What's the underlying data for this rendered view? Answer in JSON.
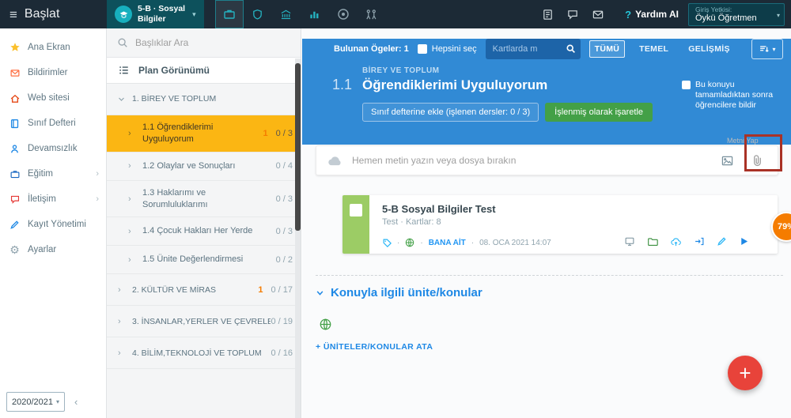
{
  "topbar": {
    "menu_label": "Başlat",
    "class_selector": {
      "line1": "5-B · Sosyal",
      "line2": "Bilgiler"
    },
    "help": {
      "q": "?",
      "label": "Yardım AI"
    },
    "role_box": {
      "label": "Giriş Yetkisi:",
      "value": "Öykü Öğretmen"
    }
  },
  "sidebar": {
    "items": [
      {
        "label": "Ana Ekran",
        "icon": "star-icon"
      },
      {
        "label": "Bildirimler",
        "icon": "mail-icon"
      },
      {
        "label": "Web sitesi",
        "icon": "home-icon"
      },
      {
        "label": "Sınıf Defteri",
        "icon": "notebook-icon"
      },
      {
        "label": "Devamsızlık",
        "icon": "person-icon"
      },
      {
        "label": "Eğitim",
        "icon": "briefcase-icon",
        "chevron": true
      },
      {
        "label": "İletişim",
        "icon": "chat-icon",
        "chevron": true
      },
      {
        "label": "Kayıt Yönetimi",
        "icon": "pen-icon"
      },
      {
        "label": "Ayarlar",
        "icon": "gear-icon"
      }
    ],
    "year": "2020/2021",
    "collapse_icon": "‹",
    "gear_glyph": "⚙"
  },
  "plan_panel": {
    "search_placeholder": "Başlıklar Ara",
    "view_label": "Plan Görünümü",
    "items": [
      {
        "label": "1. BİREY VE TOPLUM",
        "type": "unit",
        "expanded": true
      },
      {
        "label": "1.1 Öğrendiklerimi Uyguluyorum",
        "badge": "1",
        "count": "0 / 3",
        "type": "topic",
        "active": true
      },
      {
        "label": "1.2 Olaylar ve Sonuçları",
        "count": "0 / 4",
        "type": "topic"
      },
      {
        "label": "1.3 Haklarımı ve Sorumluluklarımı",
        "count": "0 / 3",
        "type": "topic"
      },
      {
        "label": "1.4 Çocuk Hakları Her Yerde",
        "count": "0 / 3",
        "type": "topic"
      },
      {
        "label": "1.5 Ünite Değerlendirmesi",
        "count": "0 / 2",
        "type": "topic"
      },
      {
        "label": "2. KÜLTÜR VE MİRAS",
        "badge": "1",
        "count": "0 / 17",
        "type": "unit"
      },
      {
        "label": "3. İNSANLAR,YERLER VE ÇEVRELER",
        "count": "0 / 19",
        "type": "unit"
      },
      {
        "label": "4. BİLİM,TEKNOLOJİ VE TOPLUM",
        "count": "0 / 16",
        "type": "unit"
      }
    ]
  },
  "main": {
    "toolbar": {
      "found": "Bulunan Ögeler: 1",
      "select_all": "Hepsini seç",
      "search_placeholder": "Kartlarda m",
      "filter_all": "TÜMÜ",
      "filter_basic": "TEMEL",
      "filter_advanced": "GELİŞMİŞ"
    },
    "topic_header": {
      "unit": "BİREY VE TOPLUM",
      "number": "1.1",
      "title": "Öğrendiklerimi Uyguluyorum",
      "add_to_classbook": "Sınıf defterine ekle (işlenen dersler: 0 / 3)",
      "mark_done": "İşlenmiş olarak işaretle",
      "notify": "Bu konuyu tamamladıktan sonra öğrencilere bildir"
    },
    "composer": {
      "hint": "Hemen metin yazın veya dosya bırakın",
      "meta_top": "Metni Yap",
      "meta_bottom": "textarea"
    },
    "card": {
      "title": "5-B Sosyal Bilgiler Test",
      "subtitle": "Test · Kartlar: 8",
      "sep": "·",
      "owner": "BANA AİT",
      "date": "08. OCA 2021 14:07",
      "score": "79%"
    },
    "related": {
      "heading": "Konuyla ilgili ünite/konular",
      "assign": "+ ÜNİTELER/KONULAR ATA"
    },
    "fab": "+"
  },
  "palette": {
    "topbar_bg": "#1c2a36",
    "teal_accent": "#17b0be",
    "header_blue": "#318ad5",
    "active_yellow": "#fbb613",
    "green_button": "#43a047",
    "fab_red": "#e8433a",
    "badge_orange": "#f57c00",
    "card_green": "#9ccc65",
    "annotation_red": "#a93226"
  }
}
